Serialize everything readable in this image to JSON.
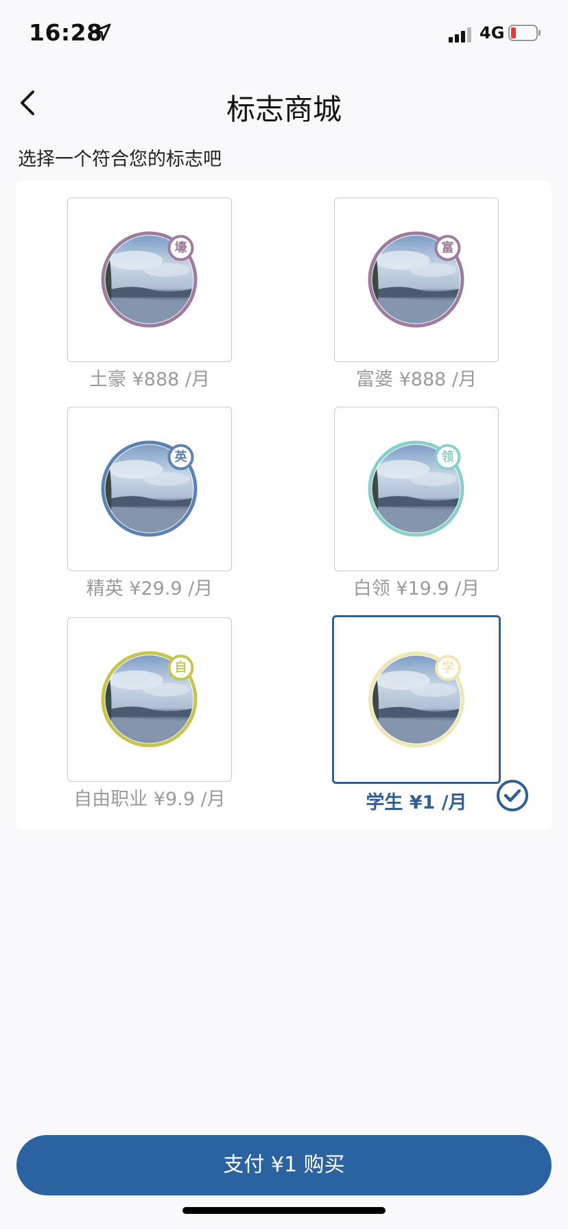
{
  "status": {
    "time": "16:28",
    "network": "4G"
  },
  "nav": {
    "title": "标志商城"
  },
  "subtitle": "选择一个符合您的标志吧",
  "badges": [
    {
      "char": "壕",
      "label": "土豪 ¥888 /月",
      "color": "#a07ba0",
      "selected": false
    },
    {
      "char": "富",
      "label": "富婆 ¥888 /月",
      "color": "#a07ba0",
      "selected": false
    },
    {
      "char": "英",
      "label": "精英 ¥29.9 /月",
      "color": "#5b82b4",
      "selected": false
    },
    {
      "char": "领",
      "label": "白领 ¥19.9 /月",
      "color": "#88d0c8",
      "selected": false
    },
    {
      "char": "自",
      "label": "自由职业 ¥9.9 /月",
      "color": "#c6c44e",
      "selected": false
    },
    {
      "char": "学",
      "label": "学生 ¥1 /月",
      "color": "#f0e6b4",
      "selected": true
    }
  ],
  "pay_button": "支付 ¥1 购买"
}
